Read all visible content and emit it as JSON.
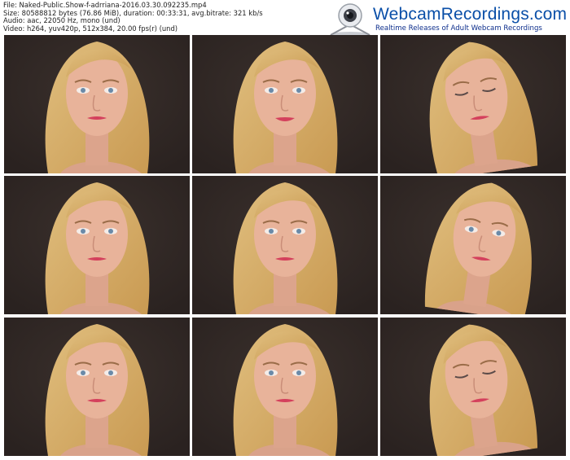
{
  "meta": {
    "file": "File: Naked-Public.Show-f-adrriana-2016.03.30.092235.mp4",
    "size": "Size: 80588812 bytes (76.86 MiB), duration: 00:33:31, avg.bitrate: 321 kb/s",
    "audio": "Audio: aac, 22050 Hz, mono (und)",
    "video": "Video: h264, yuv420p, 512x384, 20.00 fps(r) (und)"
  },
  "logo": {
    "title": "WebcamRecordings.com",
    "tagline": "Realtime Releases of Adult Webcam Recordings"
  },
  "colors": {
    "logo_blue": "#0a4fa8",
    "tagline_blue": "#0d2e8c",
    "hair": "#c99a52",
    "skin": "#e8b39a",
    "background": "#2a2220"
  },
  "thumbnails": [
    {
      "pose": "front"
    },
    {
      "pose": "smile"
    },
    {
      "pose": "down-left"
    },
    {
      "pose": "front"
    },
    {
      "pose": "front"
    },
    {
      "pose": "turn-right"
    },
    {
      "pose": "front"
    },
    {
      "pose": "front"
    },
    {
      "pose": "down-left"
    }
  ]
}
